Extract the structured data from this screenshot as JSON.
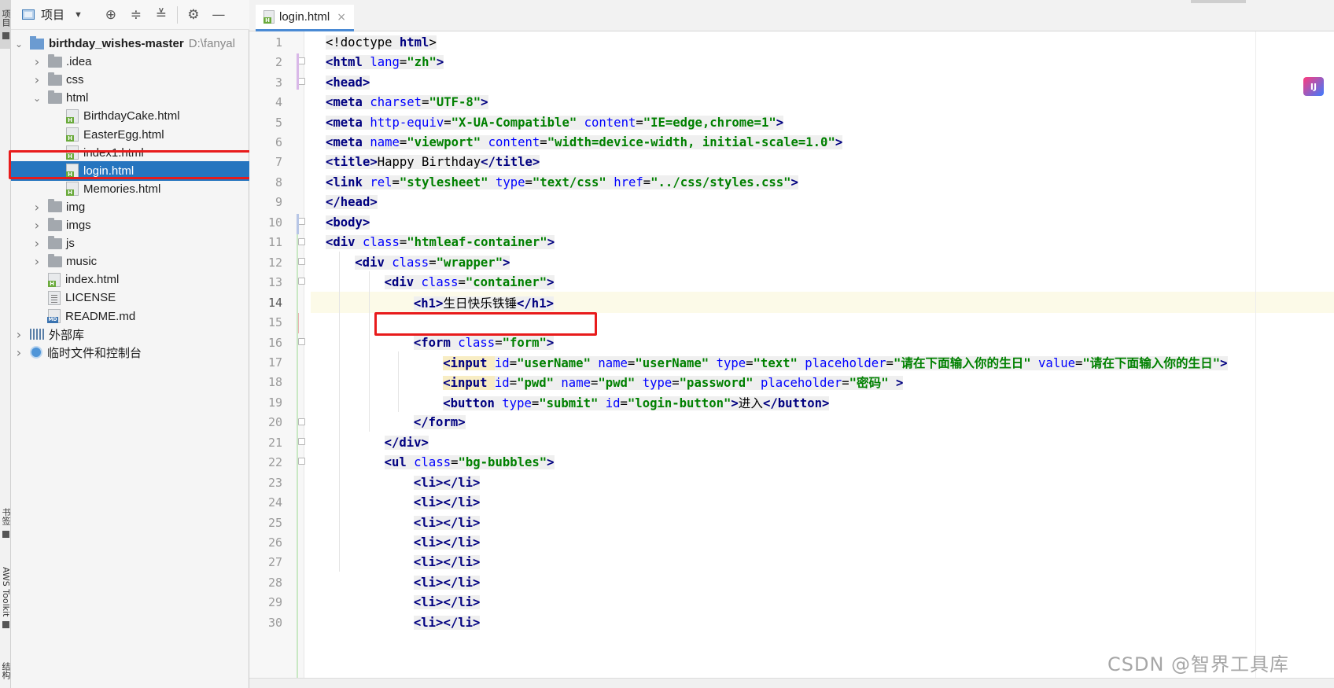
{
  "left_strip": {
    "project_tab": "项目",
    "bookmarks_tab": "书签",
    "aws_tab": "AWS Toolkit",
    "structure_tab": "结构"
  },
  "panel": {
    "title": "项目",
    "toolbar_icons": [
      "locate-icon",
      "expand-all-icon",
      "collapse-all-icon",
      "gear-icon",
      "minimize-icon"
    ]
  },
  "tree": [
    {
      "depth": 0,
      "expanded": true,
      "kind": "root",
      "name": "birthday_wishes-master",
      "path": "D:\\fanyal"
    },
    {
      "depth": 1,
      "expanded": false,
      "kind": "folder",
      "name": ".idea"
    },
    {
      "depth": 1,
      "expanded": false,
      "kind": "folder",
      "name": "css"
    },
    {
      "depth": 1,
      "expanded": true,
      "kind": "folder",
      "name": "html"
    },
    {
      "depth": 2,
      "kind": "html",
      "name": "BirthdayCake.html"
    },
    {
      "depth": 2,
      "kind": "html",
      "name": "EasterEgg.html"
    },
    {
      "depth": 2,
      "kind": "html",
      "name": "index1.html"
    },
    {
      "depth": 2,
      "kind": "html",
      "name": "login.html",
      "selected": true
    },
    {
      "depth": 2,
      "kind": "html",
      "name": "Memories.html"
    },
    {
      "depth": 1,
      "expanded": false,
      "kind": "folder",
      "name": "img"
    },
    {
      "depth": 1,
      "expanded": false,
      "kind": "folder",
      "name": "imgs"
    },
    {
      "depth": 1,
      "expanded": false,
      "kind": "folder",
      "name": "js"
    },
    {
      "depth": 1,
      "expanded": false,
      "kind": "folder",
      "name": "music"
    },
    {
      "depth": 1,
      "kind": "html",
      "name": "index.html"
    },
    {
      "depth": 1,
      "kind": "txt",
      "name": "LICENSE"
    },
    {
      "depth": 1,
      "kind": "md",
      "name": "README.md"
    },
    {
      "depth": 0,
      "expanded": false,
      "kind": "lib",
      "name": "外部库"
    },
    {
      "depth": 0,
      "expanded": false,
      "kind": "scratch",
      "name": "临时文件和控制台"
    }
  ],
  "editor": {
    "tab_label": "login.html",
    "current_line": 14,
    "lines": [
      {
        "n": "1",
        "indent": 0,
        "parts": [
          [
            "txt",
            "<!doctype "
          ],
          [
            "tag",
            "html"
          ],
          [
            "txt",
            ">"
          ]
        ]
      },
      {
        "n": "2",
        "indent": 0,
        "parts": [
          [
            "tag",
            "<html "
          ],
          [
            "attr",
            "lang"
          ],
          [
            "txt",
            "="
          ],
          [
            "val",
            "\"zh\""
          ],
          [
            "tag",
            ">"
          ]
        ]
      },
      {
        "n": "3",
        "indent": 0,
        "parts": [
          [
            "tag",
            "<head>"
          ]
        ]
      },
      {
        "n": "4",
        "indent": 0,
        "parts": [
          [
            "tag",
            "<meta "
          ],
          [
            "attr",
            "charset"
          ],
          [
            "txt",
            "="
          ],
          [
            "val",
            "\"UTF-8\""
          ],
          [
            "tag",
            ">"
          ]
        ]
      },
      {
        "n": "5",
        "indent": 0,
        "parts": [
          [
            "tag",
            "<meta "
          ],
          [
            "attr",
            "http-equiv"
          ],
          [
            "txt",
            "="
          ],
          [
            "val",
            "\"X-UA-Compatible\" "
          ],
          [
            "attr",
            "content"
          ],
          [
            "txt",
            "="
          ],
          [
            "val",
            "\"IE=edge,chrome=1\""
          ],
          [
            "tag",
            ">"
          ]
        ]
      },
      {
        "n": "6",
        "indent": 0,
        "parts": [
          [
            "tag",
            "<meta "
          ],
          [
            "attr",
            "name"
          ],
          [
            "txt",
            "="
          ],
          [
            "val",
            "\"viewport\" "
          ],
          [
            "attr",
            "content"
          ],
          [
            "txt",
            "="
          ],
          [
            "val",
            "\"width=device-width, initial-scale=1.0\""
          ],
          [
            "tag",
            ">"
          ]
        ]
      },
      {
        "n": "7",
        "indent": 0,
        "parts": [
          [
            "tag",
            "<title>"
          ],
          [
            "txt",
            "Happy Birthday"
          ],
          [
            "tag",
            "</title>"
          ]
        ]
      },
      {
        "n": "8",
        "indent": 0,
        "parts": [
          [
            "tag",
            "<link "
          ],
          [
            "attr",
            "rel"
          ],
          [
            "txt",
            "="
          ],
          [
            "val",
            "\"stylesheet\" "
          ],
          [
            "attr",
            "type"
          ],
          [
            "txt",
            "="
          ],
          [
            "val",
            "\"text/css\" "
          ],
          [
            "attr",
            "href"
          ],
          [
            "txt",
            "="
          ],
          [
            "val",
            "\"../css/styles.css\""
          ],
          [
            "tag",
            ">"
          ]
        ]
      },
      {
        "n": "9",
        "indent": 0,
        "parts": [
          [
            "tag",
            "</head>"
          ]
        ]
      },
      {
        "n": "10",
        "indent": 0,
        "parts": [
          [
            "tag",
            "<body>"
          ]
        ]
      },
      {
        "n": "11",
        "indent": 0,
        "parts": [
          [
            "tag",
            "<div "
          ],
          [
            "attr",
            "class"
          ],
          [
            "txt",
            "="
          ],
          [
            "val",
            "\"htmleaf-container\""
          ],
          [
            "tag",
            ">"
          ]
        ]
      },
      {
        "n": "12",
        "indent": 1,
        "parts": [
          [
            "tag",
            "<div "
          ],
          [
            "attr",
            "class"
          ],
          [
            "txt",
            "="
          ],
          [
            "val",
            "\"wrapper\""
          ],
          [
            "tag",
            ">"
          ]
        ]
      },
      {
        "n": "13",
        "indent": 2,
        "parts": [
          [
            "tag",
            "<div "
          ],
          [
            "attr",
            "class"
          ],
          [
            "txt",
            "="
          ],
          [
            "val",
            "\"container\""
          ],
          [
            "tag",
            ">"
          ]
        ]
      },
      {
        "n": "14",
        "indent": 3,
        "parts": [
          [
            "tag",
            "<h1>"
          ],
          [
            "txt",
            "生日快乐铁锤"
          ],
          [
            "tag",
            "</h1>"
          ]
        ]
      },
      {
        "n": "15",
        "indent": 0,
        "parts": []
      },
      {
        "n": "16",
        "indent": 3,
        "parts": [
          [
            "tag",
            "<form "
          ],
          [
            "attr",
            "class"
          ],
          [
            "txt",
            "="
          ],
          [
            "val",
            "\"form\""
          ],
          [
            "tag",
            ">"
          ]
        ]
      },
      {
        "n": "17",
        "indent": 4,
        "parts": [
          [
            "tagi",
            "<input "
          ],
          [
            "attr",
            "id"
          ],
          [
            "txt",
            "="
          ],
          [
            "val",
            "\"userName\" "
          ],
          [
            "attr",
            "name"
          ],
          [
            "txt",
            "="
          ],
          [
            "val",
            "\"userName\" "
          ],
          [
            "attr",
            "type"
          ],
          [
            "txt",
            "="
          ],
          [
            "val",
            "\"text\" "
          ],
          [
            "attr",
            "placeholder"
          ],
          [
            "txt",
            "="
          ],
          [
            "val",
            "\"请在下面输入你的生日\" "
          ],
          [
            "attr",
            "value"
          ],
          [
            "txt",
            "="
          ],
          [
            "val",
            "\"请在下面输入你的生日\""
          ],
          [
            "tag",
            ">"
          ]
        ]
      },
      {
        "n": "18",
        "indent": 4,
        "parts": [
          [
            "tagi",
            "<input "
          ],
          [
            "attr",
            "id"
          ],
          [
            "txt",
            "="
          ],
          [
            "val",
            "\"pwd\" "
          ],
          [
            "attr",
            "name"
          ],
          [
            "txt",
            "="
          ],
          [
            "val",
            "\"pwd\" "
          ],
          [
            "attr",
            "type"
          ],
          [
            "txt",
            "="
          ],
          [
            "val",
            "\"password\" "
          ],
          [
            "attr",
            "placeholder"
          ],
          [
            "txt",
            "="
          ],
          [
            "val",
            "\"密码\" "
          ],
          [
            "tag",
            ">"
          ]
        ]
      },
      {
        "n": "19",
        "indent": 4,
        "parts": [
          [
            "tag",
            "<button "
          ],
          [
            "attr",
            "type"
          ],
          [
            "txt",
            "="
          ],
          [
            "val",
            "\"submit\" "
          ],
          [
            "attr",
            "id"
          ],
          [
            "txt",
            "="
          ],
          [
            "val",
            "\"login-button\""
          ],
          [
            "tag",
            ">"
          ],
          [
            "txt",
            "进入"
          ],
          [
            "tag",
            "</button>"
          ]
        ]
      },
      {
        "n": "20",
        "indent": 3,
        "parts": [
          [
            "tag",
            "</form>"
          ]
        ]
      },
      {
        "n": "21",
        "indent": 2,
        "parts": [
          [
            "tag",
            "</div>"
          ]
        ]
      },
      {
        "n": "22",
        "indent": 2,
        "parts": [
          [
            "tag",
            "<ul "
          ],
          [
            "attr",
            "class"
          ],
          [
            "txt",
            "="
          ],
          [
            "val",
            "\"bg-bubbles\""
          ],
          [
            "tag",
            ">"
          ]
        ]
      },
      {
        "n": "23",
        "indent": 3,
        "parts": [
          [
            "tag",
            "<li></li>"
          ]
        ]
      },
      {
        "n": "24",
        "indent": 3,
        "parts": [
          [
            "tag",
            "<li></li>"
          ]
        ]
      },
      {
        "n": "25",
        "indent": 3,
        "parts": [
          [
            "tag",
            "<li></li>"
          ]
        ]
      },
      {
        "n": "26",
        "indent": 3,
        "parts": [
          [
            "tag",
            "<li></li>"
          ]
        ]
      },
      {
        "n": "27",
        "indent": 3,
        "parts": [
          [
            "tag",
            "<li></li>"
          ]
        ]
      },
      {
        "n": "28",
        "indent": 3,
        "parts": [
          [
            "tag",
            "<li></li>"
          ]
        ]
      },
      {
        "n": "29",
        "indent": 3,
        "parts": [
          [
            "tag",
            "<li></li>"
          ]
        ]
      },
      {
        "n": "30",
        "indent": 3,
        "parts": [
          [
            "tag",
            "<li></li>"
          ]
        ]
      }
    ]
  },
  "badge": {
    "label": "IJ"
  },
  "watermark": "CSDN @智界工具库",
  "colors": {
    "selection": "#2675bf",
    "annotation": "#e81b1b",
    "tag": "#000080",
    "attr": "#0000ff",
    "value": "#008000"
  }
}
